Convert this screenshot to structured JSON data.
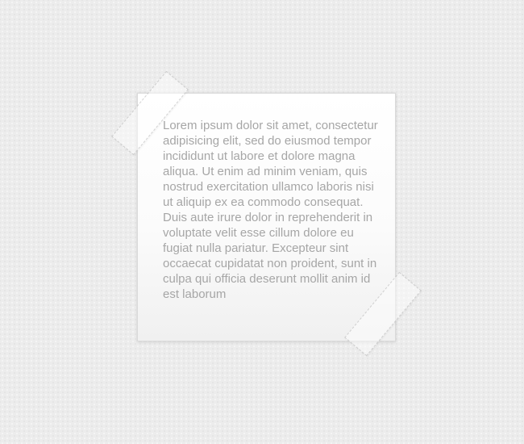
{
  "note": {
    "text": "Lorem ipsum dolor sit amet, consectetur adipisicing elit, sed do eiusmod tempor incididunt ut labore et dolore magna aliqua. Ut enim ad minim veniam, quis nostrud exercitation ullamco laboris nisi ut aliquip ex ea commodo consequat. Duis aute irure dolor in reprehenderit in voluptate velit esse cillum dolore eu fugiat nulla pariatur. Excepteur sint occaecat cupidatat non proident, sunt in culpa qui officia deserunt mollit anim id est laborum"
  },
  "colors": {
    "background": "#ececec",
    "paper": "#ffffff",
    "text": "#a6a6a6"
  }
}
